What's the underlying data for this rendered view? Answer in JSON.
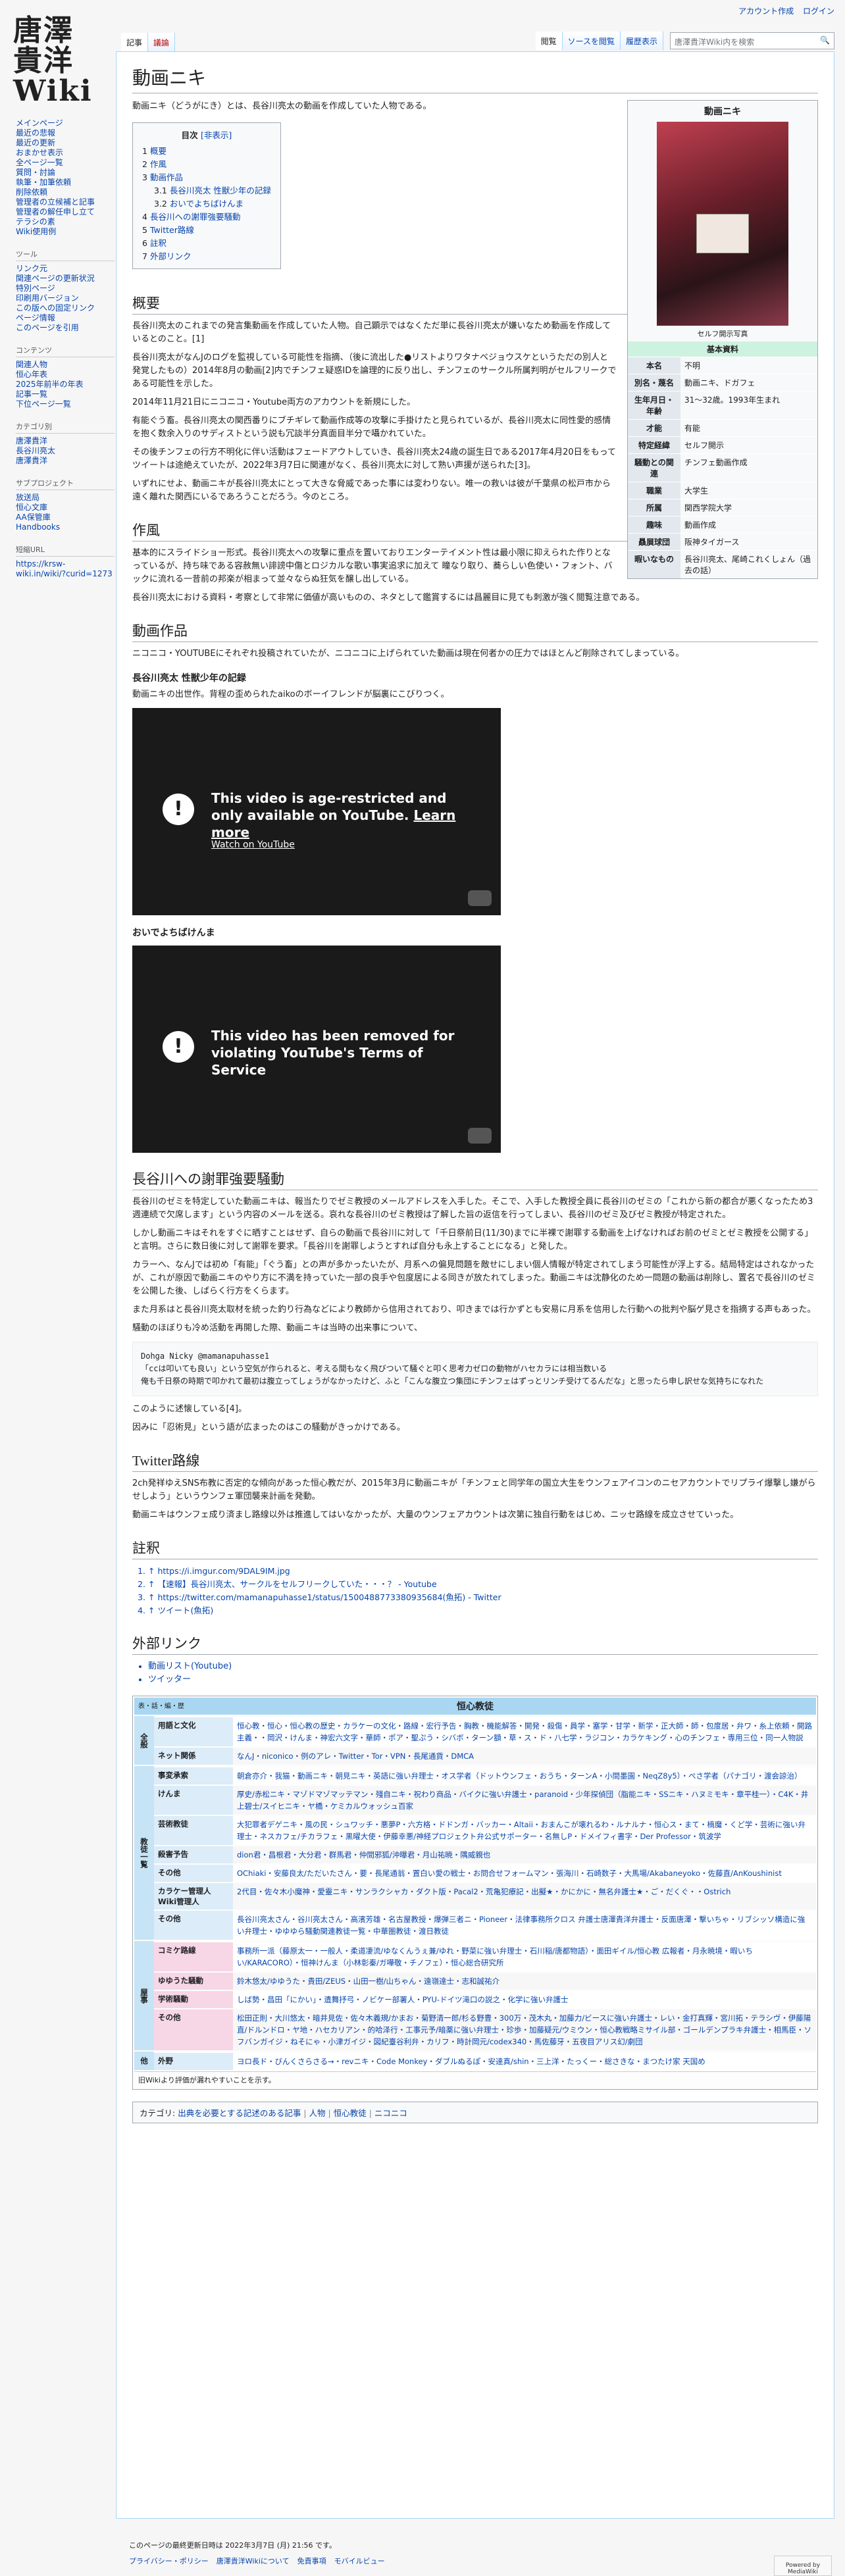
{
  "personal": {
    "create_account": "アカウント作成",
    "login": "ログイン"
  },
  "logo": {
    "line1": "唐澤",
    "line2": "貴洋",
    "line3": "Wiki"
  },
  "sidebar": {
    "portals": [
      {
        "title": "",
        "items": [
          "メインページ",
          "最近の悲報",
          "最近の更新",
          "おまかせ表示",
          "全ページ一覧",
          "質問・討論",
          "執筆・加筆依頼",
          "削除依頼",
          "管理者の立候補と記事",
          "管理者の解任申し立て",
          "テラシの素",
          "Wiki使用例"
        ]
      },
      {
        "title": "ツール",
        "items": [
          "リンク元",
          "関連ページの更新状況",
          "特別ページ",
          "印刷用バージョン",
          "この版への固定リンク",
          "ページ情報",
          "このページを引用"
        ]
      },
      {
        "title": "コンテンツ",
        "items": [
          "関連人物",
          "恒心年表",
          "2025年前半の年表",
          "記事一覧",
          "下位ページ一覧"
        ]
      },
      {
        "title": "カテゴリ別",
        "items": [
          "唐澤貴洋",
          "長谷川亮太",
          "唐澤貴洋"
        ]
      },
      {
        "title": "サブプロジェクト",
        "items": [
          "放送局",
          "恒心文庫",
          "AA保管庫",
          "Handbooks"
        ]
      },
      {
        "title": "短縮URL",
        "items": [
          "https://krsw-wiki.in/wiki/?curid=1273"
        ]
      }
    ]
  },
  "tabs": {
    "article": "記事",
    "talk": "議論",
    "read": "閲覧",
    "view_source": "ソースを閲覧",
    "history": "履歴表示",
    "search_placeholder": "唐澤貴洋Wiki内を検索"
  },
  "page": {
    "title": "動画ニキ",
    "intro": "動画ニキ（どうがにき）とは、長谷川亮太の動画を作成していた人物である。"
  },
  "infobox": {
    "title": "動画ニキ",
    "caption": "セルフ開示写真",
    "section": "基本資料",
    "rows": [
      {
        "k": "本名",
        "v": "不明"
      },
      {
        "k": "別名・蔑名",
        "v": "動画ニキ、ドガフェ"
      },
      {
        "k": "生年月日・年齢",
        "v": "31〜32歳。1993年生まれ"
      },
      {
        "k": "才能",
        "v": "有能"
      },
      {
        "k": "特定経緯",
        "v": "セルフ開示"
      },
      {
        "k": "騒動との関連",
        "v": "チンフェ動画作成"
      },
      {
        "k": "職業",
        "v": "大学生"
      },
      {
        "k": "所属",
        "v": "関西学院大学"
      },
      {
        "k": "趣味",
        "v": "動画作成"
      },
      {
        "k": "贔屓球団",
        "v": "阪神タイガース"
      },
      {
        "k": "暇いなもの",
        "v": "長谷川亮太、尾崎これくしょん（過去の話）"
      }
    ]
  },
  "toc": {
    "title": "目次",
    "hide": "[非表示]",
    "items": [
      {
        "n": "1",
        "t": "概要",
        "sub": false
      },
      {
        "n": "2",
        "t": "作風",
        "sub": false
      },
      {
        "n": "3",
        "t": "動画作品",
        "sub": false
      },
      {
        "n": "3.1",
        "t": "長谷川亮太 性獣少年の記録",
        "sub": true
      },
      {
        "n": "3.2",
        "t": "おいでよちばけんま",
        "sub": true
      },
      {
        "n": "4",
        "t": "長谷川への謝罪強要騒動",
        "sub": false
      },
      {
        "n": "5",
        "t": "Twitter路線",
        "sub": false
      },
      {
        "n": "6",
        "t": "註釈",
        "sub": false
      },
      {
        "n": "7",
        "t": "外部リンク",
        "sub": false
      }
    ]
  },
  "overview": {
    "heading": "概要",
    "p1": "長谷川亮太のこれまでの発言集動画を作成していた人物。自己顕示ではなくただ単に長谷川亮太が嫌いなため動画を作成しているとのこと。[1]",
    "p2": "長谷川亮太がなんJのログを監視している可能性を指摘、（後に流出した●リストよりワタナベジョウスケというただの別人と発覚したもの）2014年8月の動画[2]内でチンフェ疑惑IDを論理的に反り出し、チンフェのサークル所属判明がセルフリークである可能性を示した。",
    "p3": "2014年11月21日にニコニコ・Youtube両方のアカウントを新規にした。",
    "p4": "有能ぐう畜。長谷川亮太の関西番りにブチギレて動画作成等の攻撃に手掛けたと見られているが、長谷川亮太に同性愛的感情を抱く数余入りのサディストという説も冗談半分真面目半分で囁かれていた。",
    "p5": "その後チンフェの行方不明化に伴い活動はフェードアウトしていき、長谷川亮太24歳の誕生日である2017年4月20日をもってツイートは途絶えていたが、2022年3月7日に関連がなく、長谷川亮太に対して熟い声援が送られた[3]。",
    "p6": "いずれにせよ、動画ニキが長谷川亮太にとって大きな脅威であった事には変わりない。唯一の救いは彼が千葉県の松戸市から遠く離れた関西にいるであろうことだろう。今のところ。"
  },
  "style": {
    "heading": "作風",
    "p1": "基本的にスライドショー形式。長谷川亮太への攻撃に重点を置いておりエンターテイメント性は最小限に抑えられた作りとなっているが、持ち味である容赦無い誹謗中傷とロジカルな歌い事実追求に加えて 瞳なり取り、蕎らしい色使い・フォント、バックに流れる一昔前の邦楽が相まって並々ならぬ狂気を醸し出している。",
    "p2": "長谷川亮太における資料・考察として非常に価値が高いものの、ネタとして鑑賞するには昌麗目に見ても刺激が強く閲覧注意である。"
  },
  "works": {
    "heading": "動画作品",
    "intro": "ニコニコ・YOUTUBEにそれぞれ投稿されていたが、ニコニコに上げられていた動画は現在何者かの圧力ではほとんど削除されてしまっている。",
    "w1_title": "長谷川亮太 性獣少年の記録",
    "w1_desc": "動画ニキの出世作。背程の歪められたaikoのボーイフレンドが脳裏にこびりつく。",
    "video1_msg": "This video is age-restricted and only available on YouTube.",
    "video1_learn": "Learn more",
    "video1_link": "Watch on YouTube",
    "w2_title": "おいでよちばけんま",
    "video2_msg": "This video has been removed for violating YouTube's Terms of Service"
  },
  "apology": {
    "heading": "長谷川への謝罪強要騒動",
    "p1": "長谷川のゼミを特定していた動画ニキは、報当たりでゼミ教授のメールアドレスを入手した。そこで、入手した教授全員に長谷川のゼミの「これから新の都合が悪くなったため3週連続で欠席します」という内容のメールを送る。哀れな長谷川のゼミ教授は了解した旨の返信を行ってしまい、長谷川のゼミ及びゼミ教授が特定された。",
    "p2": "しかし動画ニキはそれをすぐに晒すことはせず、自らの動画で長谷川に対して「千日祭前日(11/30)までに半裸で謝罪する動画を上げなければお前のゼミとゼミ教授を公開する」と言明。さらに数日後に対して謝罪を要求。「長谷川を謝罪しようとすれば自分も永上することになる」と発した。",
    "p3": "カラーへ、なんJでは初め「有能」「ぐう畜」との声が多かったいたが、月系への偏見問題を敵せにしまい個人情報が特定されてしまう可能性が浮上する。結局特定はされなかったが、これが原因で動画ニキのやり方に不満を持っていた一部の良手や包度居による同きが放たれてしまった。動画ニキは沈静化のため一問題の動画は削除し、置名で長谷川のゼミを公開した後、しばらく行方をくらます。",
    "p4": "また月系はと長谷川亮太取材を統った釣り行為などにより教師から信用されており、叩きまでは行かずとも安易に月系を信用した行動への批判や脳ゲ見さを指摘する声もあった。",
    "p5": "騒動のほぼりも冷め活動を再開した際、動画ニキは当時の出来事について、",
    "quote": "Dohga Nicky @mamanapuhasse1\n「ccは叩いても良い」という空気が作られると、考える間もなく飛びついて騒ぐと叩く思考力ゼロの動物がハセカラには相当数いる\n俺も千日祭の時期で叩かれて最初は腹立ってしょうがなかったけど、ふと「こんな腹立つ集団にチンフェはずっとリンチ受けてるんだな」と思ったら申し訳せな気持ちになれた",
    "p6": "このように述懐している[4]。",
    "p7": "因みに「忍術見」という語が広まったのはこの騒動がきっかけである。"
  },
  "twitter": {
    "heading": "Twitter路線",
    "p1": "2ch発祥ゆえSNS布教に否定的な傾向があった恒心教だが、2015年3月に動画ニキが「チンフェと同学年の国立大生をウンフェアイコンのニセアカウントでリプライ爆撃し嫌がらせしよう」というウンフェ軍団襲来計画を発動。",
    "p2": "動画ニキはウンフェ成り済まし路線以外は推進してはいなかったが、大量のウンフェアカウントは次第に独自行動をはじめ、ニッセ路線を成立させていった。"
  },
  "notes": {
    "heading": "註釈",
    "items": [
      "↑ https://i.imgur.com/9DAL9IM.jpg",
      "↑ 【速報】長谷川亮太、サークルをセルフリークしていた・・・？ - Youtube",
      "↑ https://twitter.com/mamanapuhasse1/status/1500488773380935684(魚拓) - Twitter",
      "↑ ツイート(魚拓)"
    ]
  },
  "external": {
    "heading": "外部リンク",
    "items": [
      "動画リスト(Youtube)",
      "ツイッター"
    ]
  },
  "navbox": {
    "vte": "表・話・編・歴",
    "title": "恒心教徒",
    "groups": [
      {
        "g": "全般",
        "rows": [
          {
            "k": "用語と文化",
            "v": "恒心教・恒心・恒心教の歴史・カラケーの文化・路線・宏行予告・胸教・機能解答・開発・殺傷・員学・塞学・甘学・新学・正大師・師・包度居・弁ワ・糸上依頼・開路主義・・岡沢・けんま・神宏六文字・華師・ポア・聖ぷう・シバボ・ターン額・草・ス・ド・八七学・ラジコン・カラケキング・心のチンフェ・専用三位・同一人物説"
          },
          {
            "k": "ネット関係",
            "v": "なんJ・niconico・例のアレ・Twitter・Tor・VPN・長尾通貨・DMCA",
            "alt": true
          }
        ]
      },
      {
        "g": "教徒一覧",
        "rows": [
          {
            "k": "事変承索",
            "v": "朝倉亦介・我猫・動画ニキ・朝見ニキ・英語に強い弁理士・オス学者（ドットウンフェ・おうち・ターンA・小間墨園・NeqZ8y5）・ぺさ学者（パナゴリ・渡会諒治）"
          },
          {
            "k": "けんま",
            "v": "厚史/赤松ニキ・マゾドマゾマッテマン・殘自ニキ・祝わり商品・バイクに強い弁護士・paranoid・少年探偵団（脂能ニキ・SSニキ・ハヌミモキ・章平桂一）・C4K・井上碧士/スイヒニキ・ヤ橋・ケミカルウォッシュ百家",
            "alt": true
          },
          {
            "k": "芸術教徒",
            "v": "大犯罪者デゲニキ・風の民・シュワッチ・悪夢P・六方格・ドドンガ・バッカー・Altaii・おまんこが壊れるわ・ルナルナ・恒心ス・まて・楠魔・くど学・芸術に強い弁理士・ネスカフェ/チカラフェ・黒曜大使・伊藤幸悪/神経プロジェクト弁公式サポーター・名無しP・ドメイフィ書字・Der Professor・筑波学"
          },
          {
            "k": "殺害予告",
            "v": "dion君・昌根君・大分君・群馬君・仲間邪狐/沖曝君・月山祐暁・隅威親也",
            "alt": true
          },
          {
            "k": "その他",
            "v": "OChiaki・安藤良太/ただいたさん・要・長尾通翁・置白い愛の戦士・お問合せフォームマン・張海川・石崎数子・大馬場/Akabaneyoko・佐藤直/AnKoushinist"
          },
          {
            "k": "カラケー管理人 Wiki管理人",
            "v": "2代目・佐々木小魔神・愛靈ニキ・サンラクシャカ・ダクト版・Pacal2・荒亀犯療記・出擬★・かにかに・無名弁護士★・ご・だくぐ・・Ostrich",
            "alt": true
          },
          {
            "k": "その他",
            "v": "長谷川亮太さん・谷川亮太さん・高濱芳雄・名古屋教授・爆弾三者ニ・Pioneer・法律事務所クロス 弁護士唐澤貴洋弁護士・反面唐澤・撃いちゃ・リブシッソ構造に強い弁理士・ゆゆゆら騒動関連教徒一覧・中華圏教徒・渡日教徒"
          }
        ]
      },
      {
        "g": "屋事",
        "rows": [
          {
            "k": "コミケ路線",
            "v": "事務所一派（藤原太一・一般人・柔道凄流/ゆなくんうぇ兼/ゆれ・野菜に強い弁理士・石川稲/唐都物語）・面田ギイル/恒心教 広報者・月永暁境・暇いちい/KARACORO）・恒神けんま（小林彰秦/ガ嘩敬・チノフェ）・恒心総合研究所",
            "pk": true
          },
          {
            "k": "ゆゆうた騒動",
            "v": "鈴木悠太/ゆゆうた・貴田/ZEUS・山田一樹/山ちゃん・遠嶺達士・志和誠祐介",
            "pk": true,
            "alt": true
          },
          {
            "k": "学術騒動",
            "v": "しば勢・昌田「にかい」・遺舞抒弓・ノビケー部署人・PYU-ドイツ滝口の説之・化学に強い弁護士",
            "pk": true
          },
          {
            "k": "その他",
            "v": "松田正則・大川悠太・暗井見佐・佐々木義規/かまお・菊野清一郎/杉る野豊・300万・茂木丸・加藤力/ビースに強い弁護士・レい・金打真輝・宮川拓・テラシヴ・伊藤陽直/ドルンドロ・ヤ地・ハセカリアン・的哈泽行・工事元予/暗薬に強い弁理士・珍歩・加藤疑元/ウミウン・恒心教戦略ミサイル部・ゴールデンプラキ弁護士・相馬臣・ソフバンガイジ・ねそにゃ・小津ガイジ・図紀臺谷利弁・カリフ・時計岡元/codex340・馬佐藤牙・五夜目アリス幻/劇団",
            "pk": true,
            "alt": true
          }
        ]
      },
      {
        "g": "他",
        "rows": [
          {
            "k": "外野",
            "v": "ヨロ長ド・びんくさらさる→・revニキ・Code Monkey・ダブルぬるぽ・安達真/shin・三上洋・たっくー・総さきな・まつたけ家 天国め"
          }
        ]
      }
    ],
    "foot": "旧Wikiより評価が漏れやすいことを示す。"
  },
  "categories": {
    "label": "カテゴリ",
    "items": [
      "出典を必要とする記述のある記事",
      "人物",
      "恒心教徒",
      "ニコニコ"
    ]
  },
  "footer": {
    "modified": "このページの最終更新日時は 2022年3月7日 (月) 21:56 です。",
    "links": [
      "プライバシー・ポリシー",
      "唐澤貴洋Wikiについて",
      "免責事項",
      "モバイルビュー"
    ],
    "powered": "Powered by MediaWiki"
  }
}
